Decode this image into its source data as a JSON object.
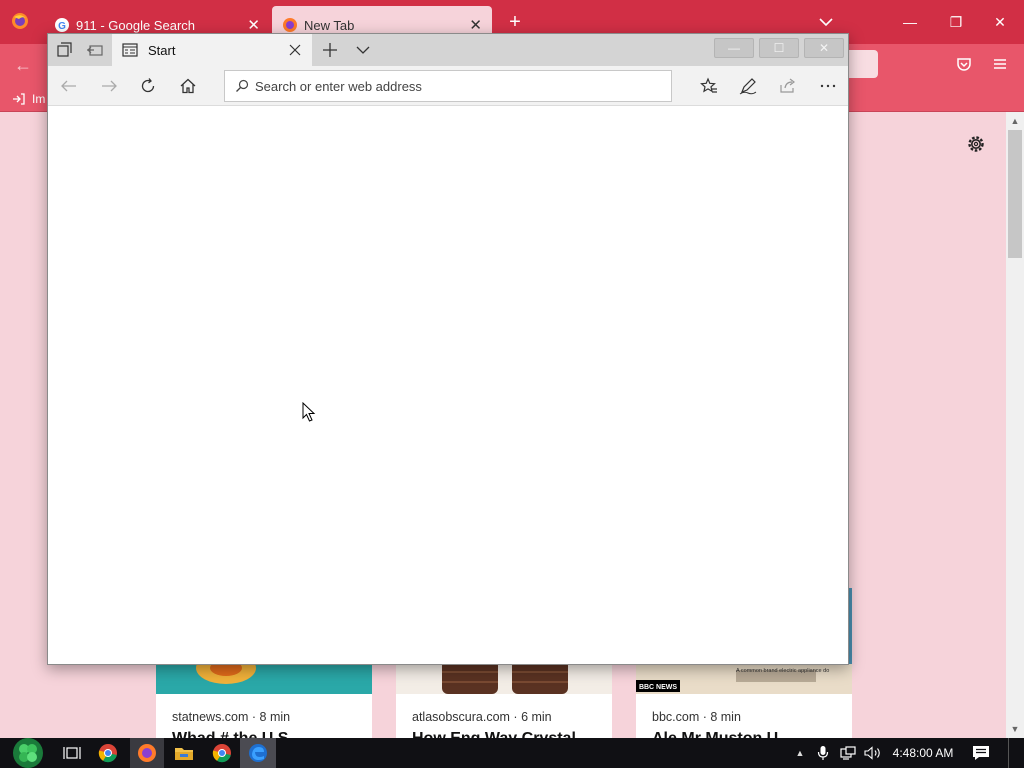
{
  "firefox": {
    "tabs": [
      {
        "label": "911 - Google Search",
        "favicon": "google-g-icon"
      },
      {
        "label": "New Tab",
        "favicon": "firefox-icon"
      }
    ],
    "bookmark_import_label": "Im",
    "cards": [
      {
        "source": "statnews.com · 8 min",
        "title": "Whad",
        "title_suffix": "# the U.S.",
        "image_color": "#2aa8a8",
        "accent_color": "#f2b23a"
      },
      {
        "source": "atlasobscura.com · 6 min",
        "title": "How Eng",
        "title_suffix": "Way Crystal",
        "image_color": "#f3ede6",
        "accent_color": "#5a3222"
      },
      {
        "source": "bbc.com · 8 min",
        "title": "Ale",
        "title_suffix": "Mr Muston U",
        "image_color": "#4a8fb0",
        "accent_color": "#e9dcc8",
        "image_text": "A common brand electric appliance do",
        "badge": "BBC NEWS"
      }
    ],
    "colors": {
      "tabbar": "#d12f45",
      "toolbar": "#e8566a",
      "page": "#f6d3da"
    }
  },
  "edge": {
    "tab_title": "Start",
    "address_placeholder": "Search or enter web address",
    "colors": {
      "titlebar": "#d4d4d4",
      "toolbar": "#f2f2f2"
    }
  },
  "taskbar": {
    "clock": "4:48:00 AM",
    "apps": [
      "start-icon",
      "task-view-icon",
      "chrome-icon",
      "firefox-icon",
      "file-explorer-icon",
      "chrome-icon",
      "edge-icon"
    ]
  }
}
